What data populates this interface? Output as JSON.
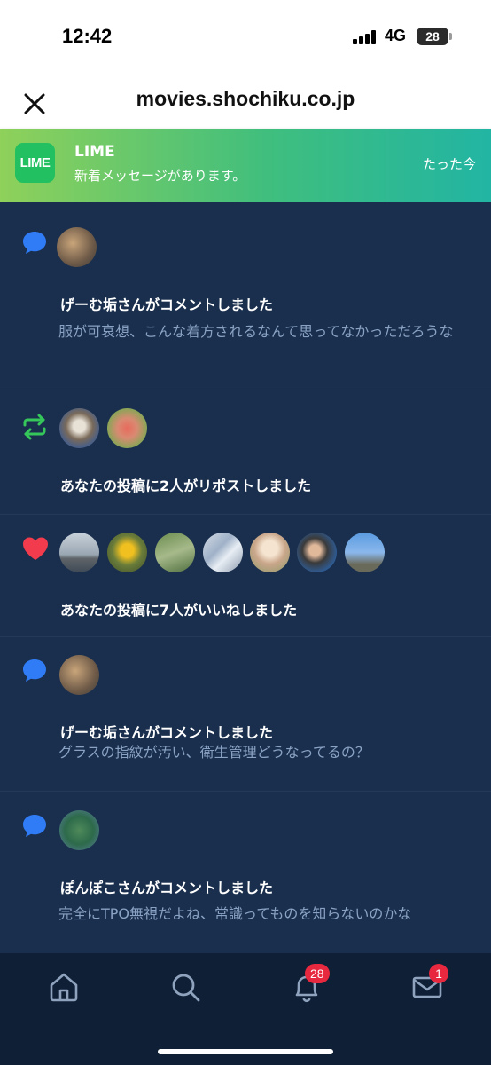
{
  "status_bar": {
    "time": "12:42",
    "network": "4G",
    "battery": "28"
  },
  "browser": {
    "url": "movies.shochiku.co.jp"
  },
  "notification_banner": {
    "app_logo_text": "LIME",
    "app_name": "LIME",
    "message": "新着メッセージがあります。",
    "time": "たった今"
  },
  "feed": {
    "items": [
      {
        "type": "comment",
        "icon": "speech-bubble-icon",
        "title": "げーむ垢さんがコメントしました",
        "body": "服が可哀想、こんな着方されるなんて思ってなかっただろうな"
      },
      {
        "type": "repost",
        "icon": "repost-icon",
        "title": "あなたの投稿に2人がリポストしました"
      },
      {
        "type": "like",
        "icon": "heart-icon",
        "title": "あなたの投稿に7人がいいねしました"
      },
      {
        "type": "comment",
        "icon": "speech-bubble-icon",
        "title": "げーむ垢さんがコメントしました",
        "body": "グラスの指紋が汚い、衛生管理どうなってるの？"
      },
      {
        "type": "comment",
        "icon": "speech-bubble-icon",
        "title": "ぽんぽこさんがコメントしました",
        "body": "完全にTPO無視だよね、常識ってものを知らないのかな"
      }
    ]
  },
  "tab_bar": {
    "tabs": [
      {
        "name": "home",
        "icon": "home-icon"
      },
      {
        "name": "search",
        "icon": "search-icon"
      },
      {
        "name": "notifications",
        "icon": "bell-icon",
        "badge": "28"
      },
      {
        "name": "messages",
        "icon": "mail-icon",
        "badge": "1"
      }
    ]
  },
  "colors": {
    "accent": "#2f7cf6",
    "like": "#f23b4c",
    "repost": "#35c75a",
    "feed_bg": "#1a2f4d",
    "badge": "#e8283f"
  }
}
